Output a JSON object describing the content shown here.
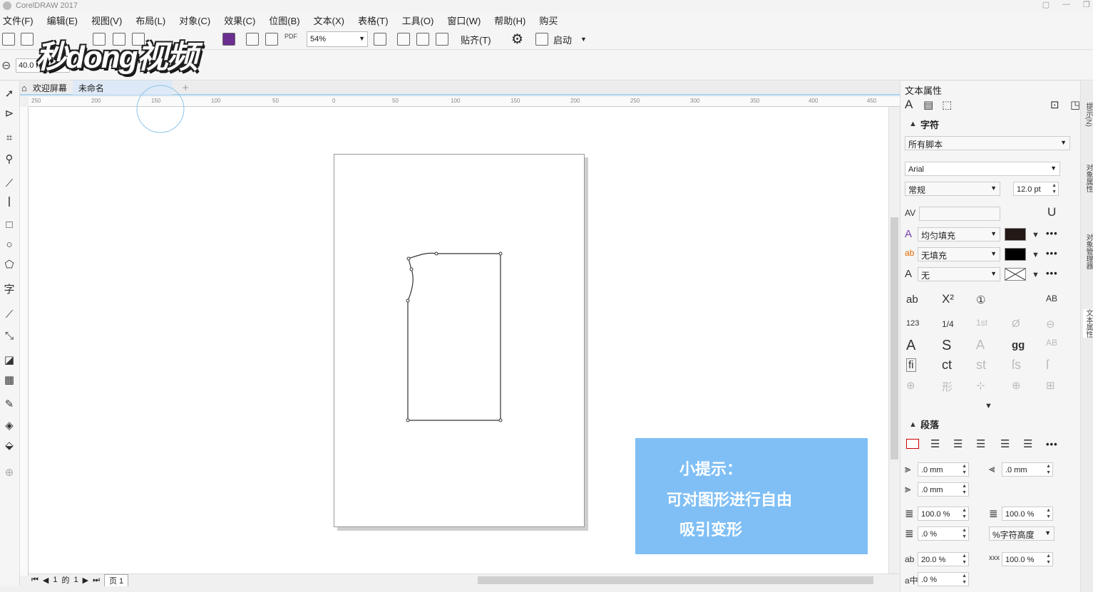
{
  "app": {
    "title": "CorelDRAW 2017"
  },
  "watermark": "秒dong视频",
  "menu": [
    "文件(F)",
    "编辑(E)",
    "视图(V)",
    "布局(L)",
    "对象(C)",
    "效果(C)",
    "位图(B)",
    "文本(X)",
    "表格(T)",
    "工具(O)",
    "窗口(W)",
    "帮助(H)",
    "购买"
  ],
  "toolbar": {
    "zoom": "54%",
    "snap": "贴齐(T)",
    "launch": "启动",
    "pdf_label": "PDF"
  },
  "property_bar": {
    "nudge": "40.0 m"
  },
  "doc_tabs": {
    "welcome": "欢迎屏幕",
    "untitled": "未命名",
    "plus": "+"
  },
  "ruler_h": [
    "250",
    "200",
    "150",
    "100",
    "50",
    "0",
    "50",
    "100",
    "150",
    "200",
    "250",
    "300",
    "350",
    "400",
    "450"
  ],
  "page_nav": {
    "current": "1",
    "of": "的",
    "total": "1",
    "page_tab": "页 1"
  },
  "tip": {
    "line1": "小提示：",
    "line2": "可对图形进行自由",
    "line3": "吸引变形"
  },
  "panel": {
    "title": "文本属性",
    "char_section": "字符",
    "script": "所有脚本",
    "font": "Arial",
    "style": "常规",
    "size": "12.0 pt",
    "fill_type": "均匀填充",
    "bg_fill": "无填充",
    "outline": "无",
    "para_section": "段落",
    "indent_left": ".0 mm",
    "indent_right": ".0 mm",
    "indent_first": ".0 mm",
    "line_spacing": "100.0 %",
    "char_spacing_pct": "100.0 %",
    "before_para": ".0 %",
    "spacing_unit": "%字符高度",
    "char_spacing": "20.0 %",
    "word_spacing": "100.0 %",
    "lang_spacing": ".0 %"
  },
  "side_tabs": [
    "提示(N)",
    "对象属性",
    "对象管理器",
    "文本属性"
  ],
  "colors": {
    "tip_bg": "#7fbff5",
    "accent": "#a9d3f0"
  }
}
